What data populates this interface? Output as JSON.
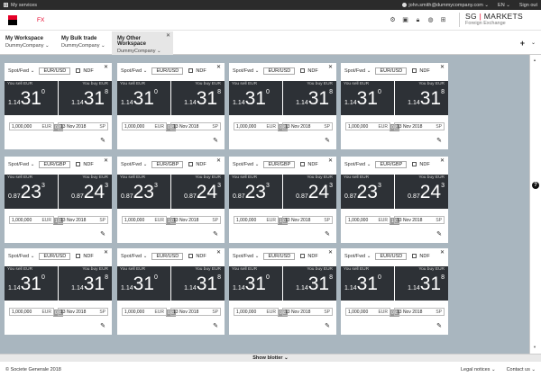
{
  "topbar": {
    "services_label": "My services",
    "user_email": "john.smith@dummycompany.com",
    "language": "EN",
    "signout_label": "Sign out"
  },
  "header": {
    "app_name": "FX",
    "brand_line1a": "SG",
    "brand_bar": "|",
    "brand_line1b": "MARKETS",
    "brand_line2": "Foreign Exchange"
  },
  "workspaces": [
    {
      "title": "My Workspace",
      "company": "DummyCompany"
    },
    {
      "title": "My Bulk trade",
      "company": "DummyCompany"
    },
    {
      "title": "My Other Workspace",
      "company": "DummyCompany"
    }
  ],
  "workspace_plus": "+",
  "tiles": [
    {
      "product": "Spot/Fwd",
      "pair": "EUR/USD",
      "ndf": "NDF",
      "sell_label": "You sell EUR",
      "buy_label": "You buy EUR",
      "sell_pre": "1.14",
      "sell_big": "31",
      "sell_sup": "0",
      "buy_pre": "1.14",
      "buy_big": "31",
      "buy_sup": "8",
      "spread": "0.8",
      "amount": "1,000,000",
      "currency": "EUR",
      "date": "13 Nov 2018",
      "tenor": "SP"
    },
    {
      "product": "Spot/Fwd",
      "pair": "EUR/USD",
      "ndf": "NDF",
      "sell_label": "You sell EUR",
      "buy_label": "You buy EUR",
      "sell_pre": "1.14",
      "sell_big": "31",
      "sell_sup": "0",
      "buy_pre": "1.14",
      "buy_big": "31",
      "buy_sup": "8",
      "spread": "0.8",
      "amount": "1,000,000",
      "currency": "EUR",
      "date": "13 Nov 2018",
      "tenor": "SP"
    },
    {
      "product": "Spot/Fwd",
      "pair": "EUR/USD",
      "ndf": "NDF",
      "sell_label": "You sell EUR",
      "buy_label": "You buy EUR",
      "sell_pre": "1.14",
      "sell_big": "31",
      "sell_sup": "0",
      "buy_pre": "1.14",
      "buy_big": "31",
      "buy_sup": "8",
      "spread": "0.8",
      "amount": "1,000,000",
      "currency": "EUR",
      "date": "13 Nov 2018",
      "tenor": "SP"
    },
    {
      "product": "Spot/Fwd",
      "pair": "EUR/USD",
      "ndf": "NDF",
      "sell_label": "You sell EUR",
      "buy_label": "You buy EUR",
      "sell_pre": "1.14",
      "sell_big": "31",
      "sell_sup": "0",
      "buy_pre": "1.14",
      "buy_big": "31",
      "buy_sup": "8",
      "spread": "0.8",
      "amount": "1,000,000",
      "currency": "EUR",
      "date": "13 Nov 2018",
      "tenor": "SP"
    },
    {
      "product": "Spot/Fwd",
      "pair": "EUR/GBP",
      "ndf": "NDF",
      "sell_label": "You sell EUR",
      "buy_label": "You buy EUR",
      "sell_pre": "0.87",
      "sell_big": "23",
      "sell_sup": "3",
      "buy_pre": "0.87",
      "buy_big": "24",
      "buy_sup": "3",
      "spread": "1.0",
      "amount": "1,000,000",
      "currency": "EUR",
      "date": "13 Nov 2018",
      "tenor": "SP"
    },
    {
      "product": "Spot/Fwd",
      "pair": "EUR/GBP",
      "ndf": "NDF",
      "sell_label": "You sell EUR",
      "buy_label": "You buy EUR",
      "sell_pre": "0.87",
      "sell_big": "23",
      "sell_sup": "3",
      "buy_pre": "0.87",
      "buy_big": "24",
      "buy_sup": "3",
      "spread": "1.0",
      "amount": "1,000,000",
      "currency": "EUR",
      "date": "13 Nov 2018",
      "tenor": "SP"
    },
    {
      "product": "Spot/Fwd",
      "pair": "EUR/GBP",
      "ndf": "NDF",
      "sell_label": "You sell EUR",
      "buy_label": "You buy EUR",
      "sell_pre": "0.87",
      "sell_big": "23",
      "sell_sup": "3",
      "buy_pre": "0.87",
      "buy_big": "24",
      "buy_sup": "3",
      "spread": "1.0",
      "amount": "1,000,000",
      "currency": "EUR",
      "date": "13 Nov 2018",
      "tenor": "SP"
    },
    {
      "product": "Spot/Fwd",
      "pair": "EUR/GBP",
      "ndf": "NDF",
      "sell_label": "You sell EUR",
      "buy_label": "You buy EUR",
      "sell_pre": "0.87",
      "sell_big": "23",
      "sell_sup": "3",
      "buy_pre": "0.87",
      "buy_big": "24",
      "buy_sup": "3",
      "spread": "1.0",
      "amount": "1,000,000",
      "currency": "EUR",
      "date": "13 Nov 2018",
      "tenor": "SP"
    },
    {
      "product": "Spot/Fwd",
      "pair": "EUR/USD",
      "ndf": "NDF",
      "sell_label": "You sell EUR",
      "buy_label": "You buy EUR",
      "sell_pre": "1.14",
      "sell_big": "31",
      "sell_sup": "0",
      "buy_pre": "1.14",
      "buy_big": "31",
      "buy_sup": "8",
      "spread": "0.8",
      "amount": "1,000,000",
      "currency": "EUR",
      "date": "13 Nov 2018",
      "tenor": "SP"
    },
    {
      "product": "Spot/Fwd",
      "pair": "EUR/USD",
      "ndf": "NDF",
      "sell_label": "You sell EUR",
      "buy_label": "You buy EUR",
      "sell_pre": "1.14",
      "sell_big": "31",
      "sell_sup": "0",
      "buy_pre": "1.14",
      "buy_big": "31",
      "buy_sup": "8",
      "spread": "0.8",
      "amount": "1,000,000",
      "currency": "EUR",
      "date": "13 Nov 2018",
      "tenor": "SP"
    },
    {
      "product": "Spot/Fwd",
      "pair": "EUR/USD",
      "ndf": "NDF",
      "sell_label": "You sell EUR",
      "buy_label": "You buy EUR",
      "sell_pre": "1.14",
      "sell_big": "31",
      "sell_sup": "0",
      "buy_pre": "1.14",
      "buy_big": "31",
      "buy_sup": "8",
      "spread": "0.8",
      "amount": "1,000,000",
      "currency": "EUR",
      "date": "13 Nov 2018",
      "tenor": "SP"
    },
    {
      "product": "Spot/Fwd",
      "pair": "EUR/USD",
      "ndf": "NDF",
      "sell_label": "You sell EUR",
      "buy_label": "You buy EUR",
      "sell_pre": "1.14",
      "sell_big": "31",
      "sell_sup": "0",
      "buy_pre": "1.14",
      "buy_big": "31",
      "buy_sup": "8",
      "spread": "0.8",
      "amount": "1,000,000",
      "currency": "EUR",
      "date": "13 Nov 2018",
      "tenor": "SP"
    }
  ],
  "blotter_label": "Show blotter",
  "footer": {
    "copyright": "© Societe Generale 2018",
    "legal": "Legal notices",
    "contact": "Contact us"
  },
  "colors": {
    "brand_red": "#e60028",
    "price_panel": "#2d3136",
    "canvas": "#a9b6bf"
  }
}
